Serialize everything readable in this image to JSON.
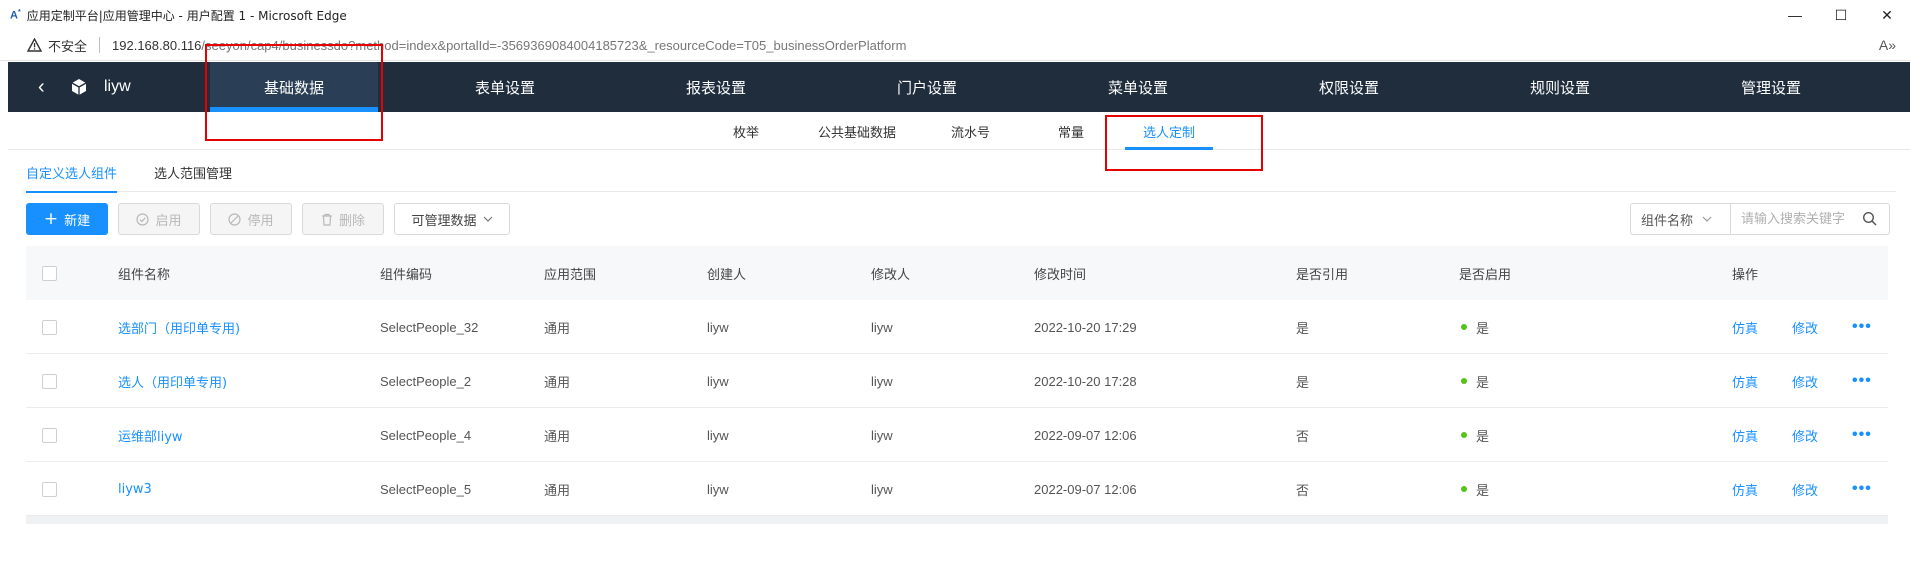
{
  "browser": {
    "title": "应用定制平台|应用管理中心 - 用户配置 1 - Microsoft Edge",
    "insecure_label": "不安全",
    "url_host": "192.168.80.116",
    "url_path": "/seeyon/cap4/businessdo?method=index&portalId=-3569369084004185723&_resourceCode=T05_businessOrderPlatform",
    "minimize": "—",
    "maximize": "☐",
    "close": "✕",
    "read_aloud": "A»"
  },
  "appnav": {
    "back": "‹",
    "user": "liyw",
    "tabs": [
      {
        "label": "基础数据",
        "active": true
      },
      {
        "label": "表单设置"
      },
      {
        "label": "报表设置"
      },
      {
        "label": "门户设置"
      },
      {
        "label": "菜单设置"
      },
      {
        "label": "权限设置"
      },
      {
        "label": "规则设置"
      },
      {
        "label": "管理设置"
      }
    ]
  },
  "subnav": {
    "tabs": [
      {
        "label": "枚举"
      },
      {
        "label": "公共基础数据"
      },
      {
        "label": "流水号"
      },
      {
        "label": "常量"
      },
      {
        "label": "选人定制",
        "active": true
      }
    ]
  },
  "content_tabs": [
    {
      "label": "自定义选人组件",
      "active": true
    },
    {
      "label": "选人范围管理"
    }
  ],
  "toolbar": {
    "new_label": "新建",
    "enable_label": "启用",
    "disable_label": "停用",
    "delete_label": "删除",
    "manage_data_label": "可管理数据",
    "search_field_label": "组件名称",
    "search_placeholder": "请输入搜索关键字"
  },
  "table": {
    "columns": [
      "组件名称",
      "组件编码",
      "应用范围",
      "创建人",
      "修改人",
      "修改时间",
      "是否引用",
      "是否启用",
      "操作"
    ],
    "rows": [
      {
        "name": "选部门（用印单专用)",
        "code": "SelectPeople_32",
        "scope": "通用",
        "creator": "liyw",
        "modifier": "liyw",
        "time": "2022-10-20 17:29",
        "referenced": "是",
        "enabled": "是",
        "simulate": "仿真",
        "edit": "修改",
        "more": "•••"
      },
      {
        "name": "选人（用印单专用)",
        "code": "SelectPeople_2",
        "scope": "通用",
        "creator": "liyw",
        "modifier": "liyw",
        "time": "2022-10-20 17:28",
        "referenced": "是",
        "enabled": "是",
        "simulate": "仿真",
        "edit": "修改",
        "more": "•••"
      },
      {
        "name": "运维部liyw",
        "code": "SelectPeople_4",
        "scope": "通用",
        "creator": "liyw",
        "modifier": "liyw",
        "time": "2022-09-07 12:06",
        "referenced": "否",
        "enabled": "是",
        "simulate": "仿真",
        "edit": "修改",
        "more": "•••"
      },
      {
        "name": "liyw3",
        "code": "SelectPeople_5",
        "scope": "通用",
        "creator": "liyw",
        "modifier": "liyw",
        "time": "2022-09-07 12:06",
        "referenced": "否",
        "enabled": "是",
        "simulate": "仿真",
        "edit": "修改",
        "more": "•••"
      }
    ]
  },
  "colors": {
    "nav_bg": "#1f2d3d",
    "accent": "#1890ff",
    "status_green": "#52c41a",
    "highlight_red": "#e60000"
  }
}
